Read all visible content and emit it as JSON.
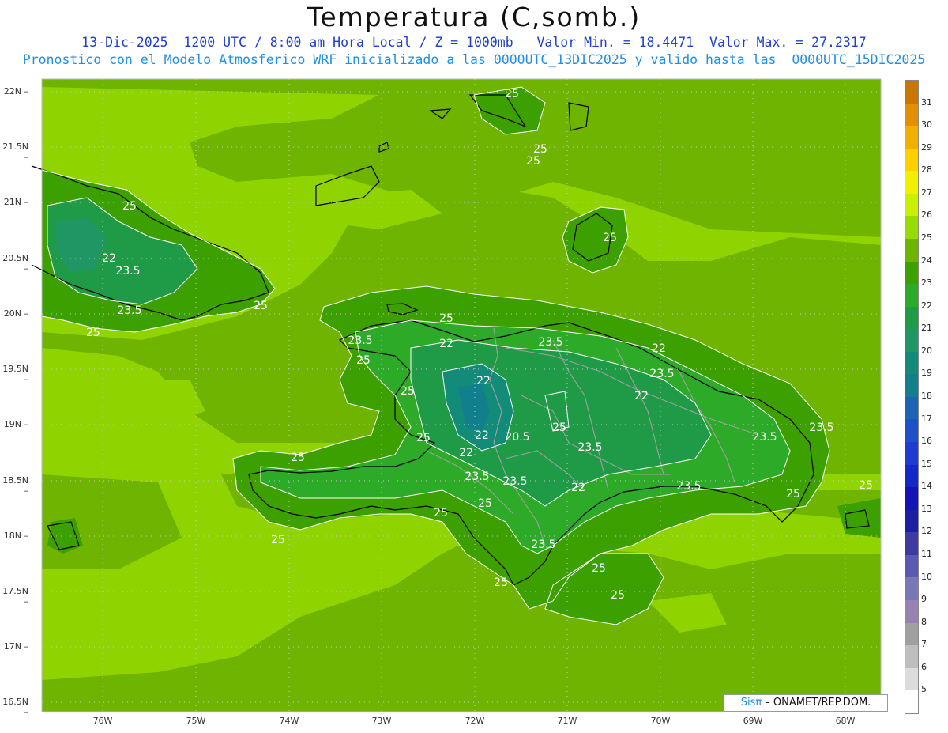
{
  "header": {
    "title": "Temperatura (C,somb.)",
    "line1": "13-Dic-2025  1200 UTC / 8:00 am Hora Local / Z = 1000mb   Valor Min. = 18.4471  Valor Max. = 27.2317",
    "line2": "Pronostico con el Modelo Atmosferico WRF inicializado a las 0000UTC_13DIC2025 y valido hasta las  0000UTC_15DIC2025"
  },
  "axes": {
    "lat_labels": [
      "22N",
      "21.5N",
      "21N",
      "20.5N",
      "20N",
      "19.5N",
      "19N",
      "18.5N",
      "18N",
      "17.5N",
      "17N",
      "16.5N"
    ],
    "lon_labels": [
      "76W",
      "75W",
      "74W",
      "73W",
      "72W",
      "71W",
      "70W",
      "69W",
      "68W"
    ]
  },
  "colorbar": {
    "labels": [
      "31",
      "30",
      "29",
      "28",
      "27",
      "26",
      "25",
      "24",
      "23",
      "22",
      "21",
      "20",
      "19",
      "18",
      "17",
      "16",
      "15",
      "14",
      "13",
      "12",
      "11",
      "10",
      "9",
      "8",
      "7",
      "6",
      "5"
    ],
    "colors": [
      "#c87800",
      "#e09000",
      "#f0b000",
      "#ffd000",
      "#f0f000",
      "#c8f000",
      "#96dc00",
      "#6eb400",
      "#3ca000",
      "#2caa28",
      "#1f9a46",
      "#1f9664",
      "#128c78",
      "#12808c",
      "#1e64b4",
      "#1e50c8",
      "#1e3cd2",
      "#1428c8",
      "#1414b4",
      "#1e1ea0",
      "#3c3ca0",
      "#5a5ab4",
      "#7878b4",
      "#9682b4",
      "#a0a0a0",
      "#bebebe",
      "#dcdcdc",
      "#ffffff"
    ]
  },
  "contour_labels": [
    "25",
    "25",
    "25",
    "25",
    "22",
    "23.5",
    "23.5",
    "25",
    "25",
    "25",
    "25",
    "22",
    "23.5",
    "23.5",
    "25",
    "22",
    "22",
    "23.5",
    "25",
    "22",
    "23.5",
    "22",
    "20.5",
    "25",
    "23.5",
    "25",
    "25",
    "22",
    "23.5",
    "23.5",
    "23.5",
    "22",
    "23.5",
    "25",
    "25",
    "25",
    "25",
    "23.5",
    "25",
    "25",
    "25",
    "25"
  ],
  "credit": {
    "sis": "Sisπ",
    "org": " – ONAMET/REP.DOM."
  }
}
